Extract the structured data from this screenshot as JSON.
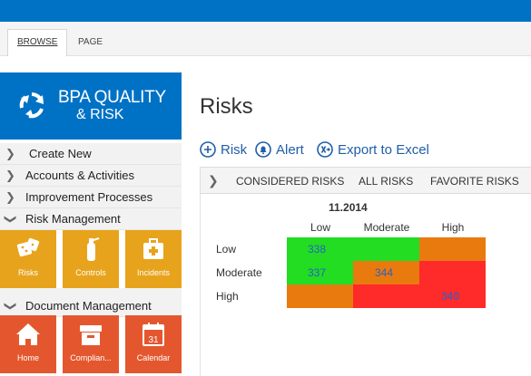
{
  "ribbon": {
    "tabs": [
      "BROWSE",
      "PAGE"
    ]
  },
  "brand": {
    "line1": "BPA QUALITY",
    "line2": "& RISK"
  },
  "nav": {
    "create_new": "Create New",
    "accounts": "Accounts & Activities",
    "improvement": "Improvement Processes",
    "risk_management": "Risk Management",
    "document_management": "Document Management"
  },
  "risk_tiles": [
    "Risks",
    "Controls",
    "Incidents"
  ],
  "doc_tiles": [
    "Home",
    "Complian...",
    "Calendar"
  ],
  "calendar_day": "31",
  "page": {
    "title": "Risks"
  },
  "actions": {
    "risk": "Risk",
    "alert": "Alert",
    "export": "Export to Excel"
  },
  "views": [
    "CONSIDERED RISKS",
    "ALL RISKS",
    "FAVORITE RISKS"
  ],
  "heatmap": {
    "title": "11.2014",
    "columns": [
      "Low",
      "Moderate",
      "High"
    ],
    "rows": [
      "Low",
      "Moderate",
      "High"
    ],
    "counts": {
      "low_low": "338",
      "moderate_low": "337",
      "moderate_moderate": "344",
      "high_high": "340"
    },
    "colors": {
      "green": "#22dd22",
      "orange": "#e87a0e",
      "red": "#ff2a2a"
    }
  },
  "colors": {
    "accent": "#0072c6",
    "tile_yellow": "#e8a31c",
    "tile_red": "#e4572e",
    "link": "#1f5ea8"
  }
}
